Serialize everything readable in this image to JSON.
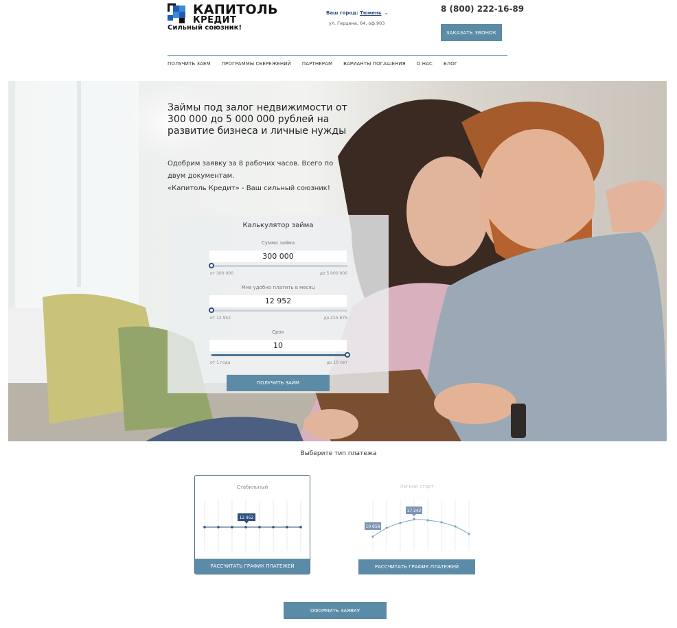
{
  "header": {
    "logo_title": "КАПИТОЛЬ",
    "logo_sub": "КРЕДИТ",
    "slogan": "Сильный союзник!",
    "city_label": "Ваш город:",
    "city": "Тюмень",
    "address": "ул. Герцена, 64, оф.903",
    "phone": "8 (800) 222-16-89",
    "callback_label": "ЗАКАЗАТЬ ЗВОНОК"
  },
  "nav": {
    "items": [
      {
        "label": "ПОЛУЧИТЬ ЗАЕМ"
      },
      {
        "label": "ПРОГРАММЫ СБЕРЕЖЕНИЙ"
      },
      {
        "label": "ПАРТНЕРАМ"
      },
      {
        "label": "ВАРИАНТЫ ПОГАШЕНИЯ"
      },
      {
        "label": "О НАС"
      },
      {
        "label": "БЛОГ"
      }
    ]
  },
  "hero": {
    "title": "Займы под залог недвижимости от 300 000 до 5 000 000 рублей на развитие бизнеса и личные нужды",
    "text_line1": "Одобрим заявку за 8 рабочих часов. Всего по двум документам.",
    "text_line2": "«Капитоль Кредит» - Ваш сильный союзник!"
  },
  "calculator": {
    "title": "Калькулятор займа",
    "amount": {
      "label": "Сумма займа",
      "value": "300 000",
      "min": "от 300 000",
      "max": "до 5 000 000",
      "level": 0.0
    },
    "monthly": {
      "label": "Мне удобно платить в месяц",
      "value": "12 952",
      "min": "от 12 952",
      "max": "до 215 875",
      "level": 0.0
    },
    "term": {
      "label": "Срок",
      "value": "10",
      "min": "от 1 года",
      "max": "до 10 лет",
      "level": 1.0
    },
    "submit_label": "ПОЛУЧИТЬ ЗАЙМ"
  },
  "payment": {
    "heading": "Выберите тип платежа",
    "stable": {
      "title": "Стабильный",
      "tooltip": "12 952",
      "button": "РАССЧИТАТЬ ГРАФИК ПЛАТЕЖЕЙ",
      "selected": true
    },
    "light": {
      "title": "Легкий старт",
      "tooltip_start": "10 858",
      "tooltip_peak": "17 242",
      "button": "РАССЧИТАТЬ ГРАФИК ПЛАТЕЖЕЙ",
      "selected": false
    }
  },
  "apply_label": "ОФОРМИТЬ ЗАЯВКУ",
  "colors": {
    "accent": "#5b8ba6",
    "dark_blue": "#2c4f7a",
    "logo_blue": "#1f5bb8"
  }
}
